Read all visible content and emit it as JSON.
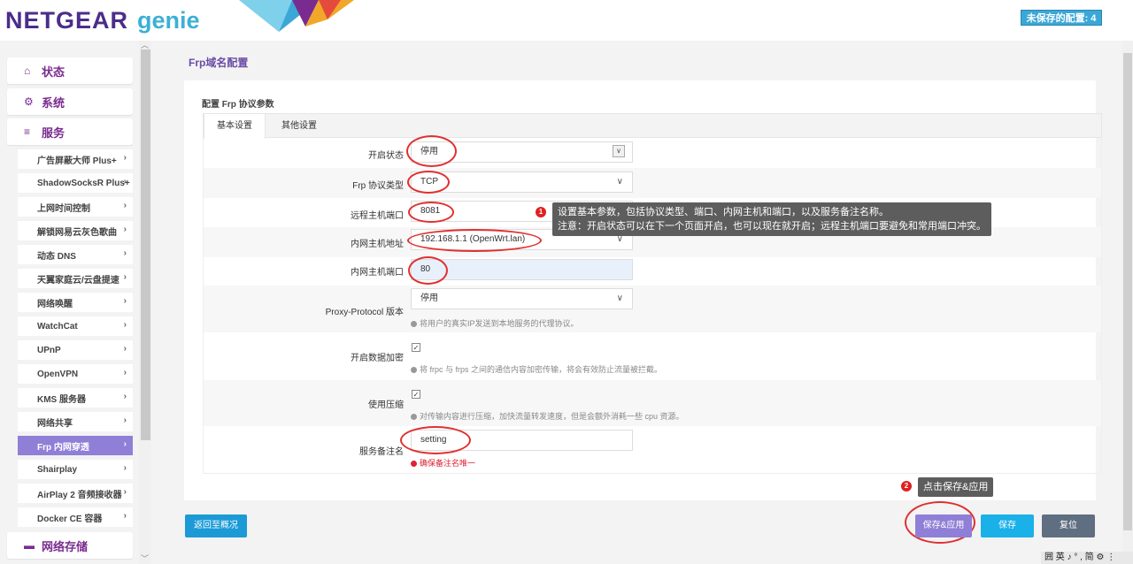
{
  "header": {
    "brand": "NETGEAR",
    "brand_suffix": "genie",
    "unsaved_label": "未保存的配置: 4"
  },
  "sidebar": {
    "top_items": [
      {
        "label": "状态",
        "icon": "home-icon"
      },
      {
        "label": "系统",
        "icon": "gears-icon"
      },
      {
        "label": "服务",
        "icon": "list-icon"
      }
    ],
    "sub_items": [
      "广告屏蔽大师 Plus+",
      "ShadowSocksR Plus+",
      "上网时间控制",
      "解锁网易云灰色歌曲",
      "动态 DNS",
      "天翼家庭云/云盘提速",
      "网络唤醒",
      "WatchCat",
      "UPnP",
      "OpenVPN",
      "KMS 服务器",
      "网络共享",
      "Frp 内网穿透",
      "Shairplay",
      "AirPlay 2 音频接收器",
      "Docker CE 容器"
    ],
    "active_sub": "Frp 内网穿透",
    "bottom_item": {
      "label": "网络存储",
      "icon": "storage-icon"
    }
  },
  "main": {
    "page_title": "Frp域名配置",
    "section_title": "配置 Frp 协议参数",
    "tabs": [
      "基本设置",
      "其他设置"
    ],
    "fields": {
      "enable_label": "开启状态",
      "enable_value": "停用",
      "protocol_label": "Frp 协议类型",
      "protocol_value": "TCP",
      "remote_port_label": "远程主机端口",
      "remote_port_value": "8081",
      "local_ip_label": "内网主机地址",
      "local_ip_value": "192.168.1.1 (OpenWrt.lan)",
      "local_port_label": "内网主机端口",
      "local_port_value": "80",
      "proxy_label": "Proxy-Protocol 版本",
      "proxy_value": "停用",
      "proxy_hint": "将用户的真实IP发送到本地服务的代理协议。",
      "encrypt_label": "开启数据加密",
      "encrypt_hint": "将 frpc 与 frps 之间的通信内容加密传输，将会有效防止流量被拦截。",
      "compress_label": "使用压缩",
      "compress_hint": "对传输内容进行压缩，加快流量转发速度，但是会额外消耗一些 cpu 资源。",
      "remark_label": "服务备注名",
      "remark_value": "setting",
      "remark_hint": "确保备注名唯一"
    },
    "tooltip1_badge": "1",
    "tooltip1_line1": "设置基本参数，包括协议类型、端口、内网主机和端口，以及服务备注名称。",
    "tooltip1_line2": "注意：开启状态可以在下一个页面开启，也可以现在就开启；远程主机端口要避免和常用端口冲突。",
    "tooltip2_badge": "2",
    "tooltip2_text": "点击保存&应用"
  },
  "buttons": {
    "back": "返回至概况",
    "save_apply": "保存&应用",
    "save": "保存",
    "reset": "复位"
  },
  "taskbar": {
    "text": "囲 英 ♪ ° , 简 ⚙ ⋮"
  },
  "colors": {
    "brand_purple": "#4b2d8a",
    "brand_blue": "#3cb0d6",
    "accent_purple": "#8f7fd6",
    "annotation_red": "#e03030"
  }
}
